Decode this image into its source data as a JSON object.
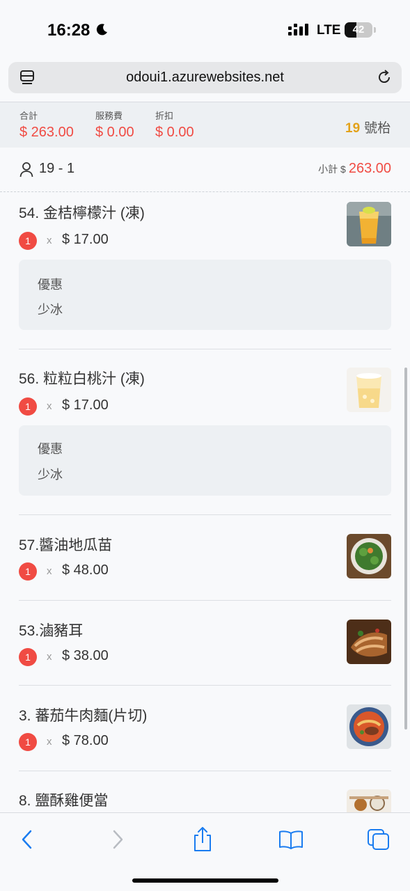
{
  "status_bar": {
    "time": "16:28",
    "network": "LTE",
    "battery": "42",
    "battery_level": 0.42
  },
  "browser": {
    "url": "odoui1.azurewebsites.net"
  },
  "summary": {
    "total_label": "合計",
    "total_value": "$ 263.00",
    "service_label": "服務費",
    "service_value": "$ 0.00",
    "discount_label": "折扣",
    "discount_value": "$ 0.00",
    "table_number": "19",
    "table_suffix": "號枱"
  },
  "guest": {
    "label": "19 - 1",
    "subtotal_label": "小計 $",
    "subtotal_value": "263.00"
  },
  "items": [
    {
      "name": "54. 金桔檸檬汁 (凍)",
      "qty": "1",
      "times": "x",
      "price": "$ 17.00",
      "note_title": "優惠",
      "note_detail": "少冰"
    },
    {
      "name": "56. 粒粒白桃汁 (凍)",
      "qty": "1",
      "times": "x",
      "price": "$ 17.00",
      "note_title": "優惠",
      "note_detail": "少冰"
    },
    {
      "name": "57.醬油地瓜苗",
      "qty": "1",
      "times": "x",
      "price": "$ 48.00"
    },
    {
      "name": "53.滷豬耳",
      "qty": "1",
      "times": "x",
      "price": "$ 38.00"
    },
    {
      "name": "3. 蕃茄牛肉麵(片切)",
      "qty": "1",
      "times": "x",
      "price": "$ 78.00"
    },
    {
      "name": "8. 鹽酥雞便當"
    }
  ],
  "colors": {
    "accent_red": "#f04b43",
    "table_gold": "#e3a21a",
    "ios_blue": "#1a7cf0"
  },
  "icons": {
    "toolbar": [
      "back-chevron-icon",
      "forward-chevron-icon",
      "share-icon",
      "bookmarks-icon",
      "tabs-icon"
    ],
    "header": [
      "reader-menu-icon",
      "reload-icon"
    ]
  }
}
